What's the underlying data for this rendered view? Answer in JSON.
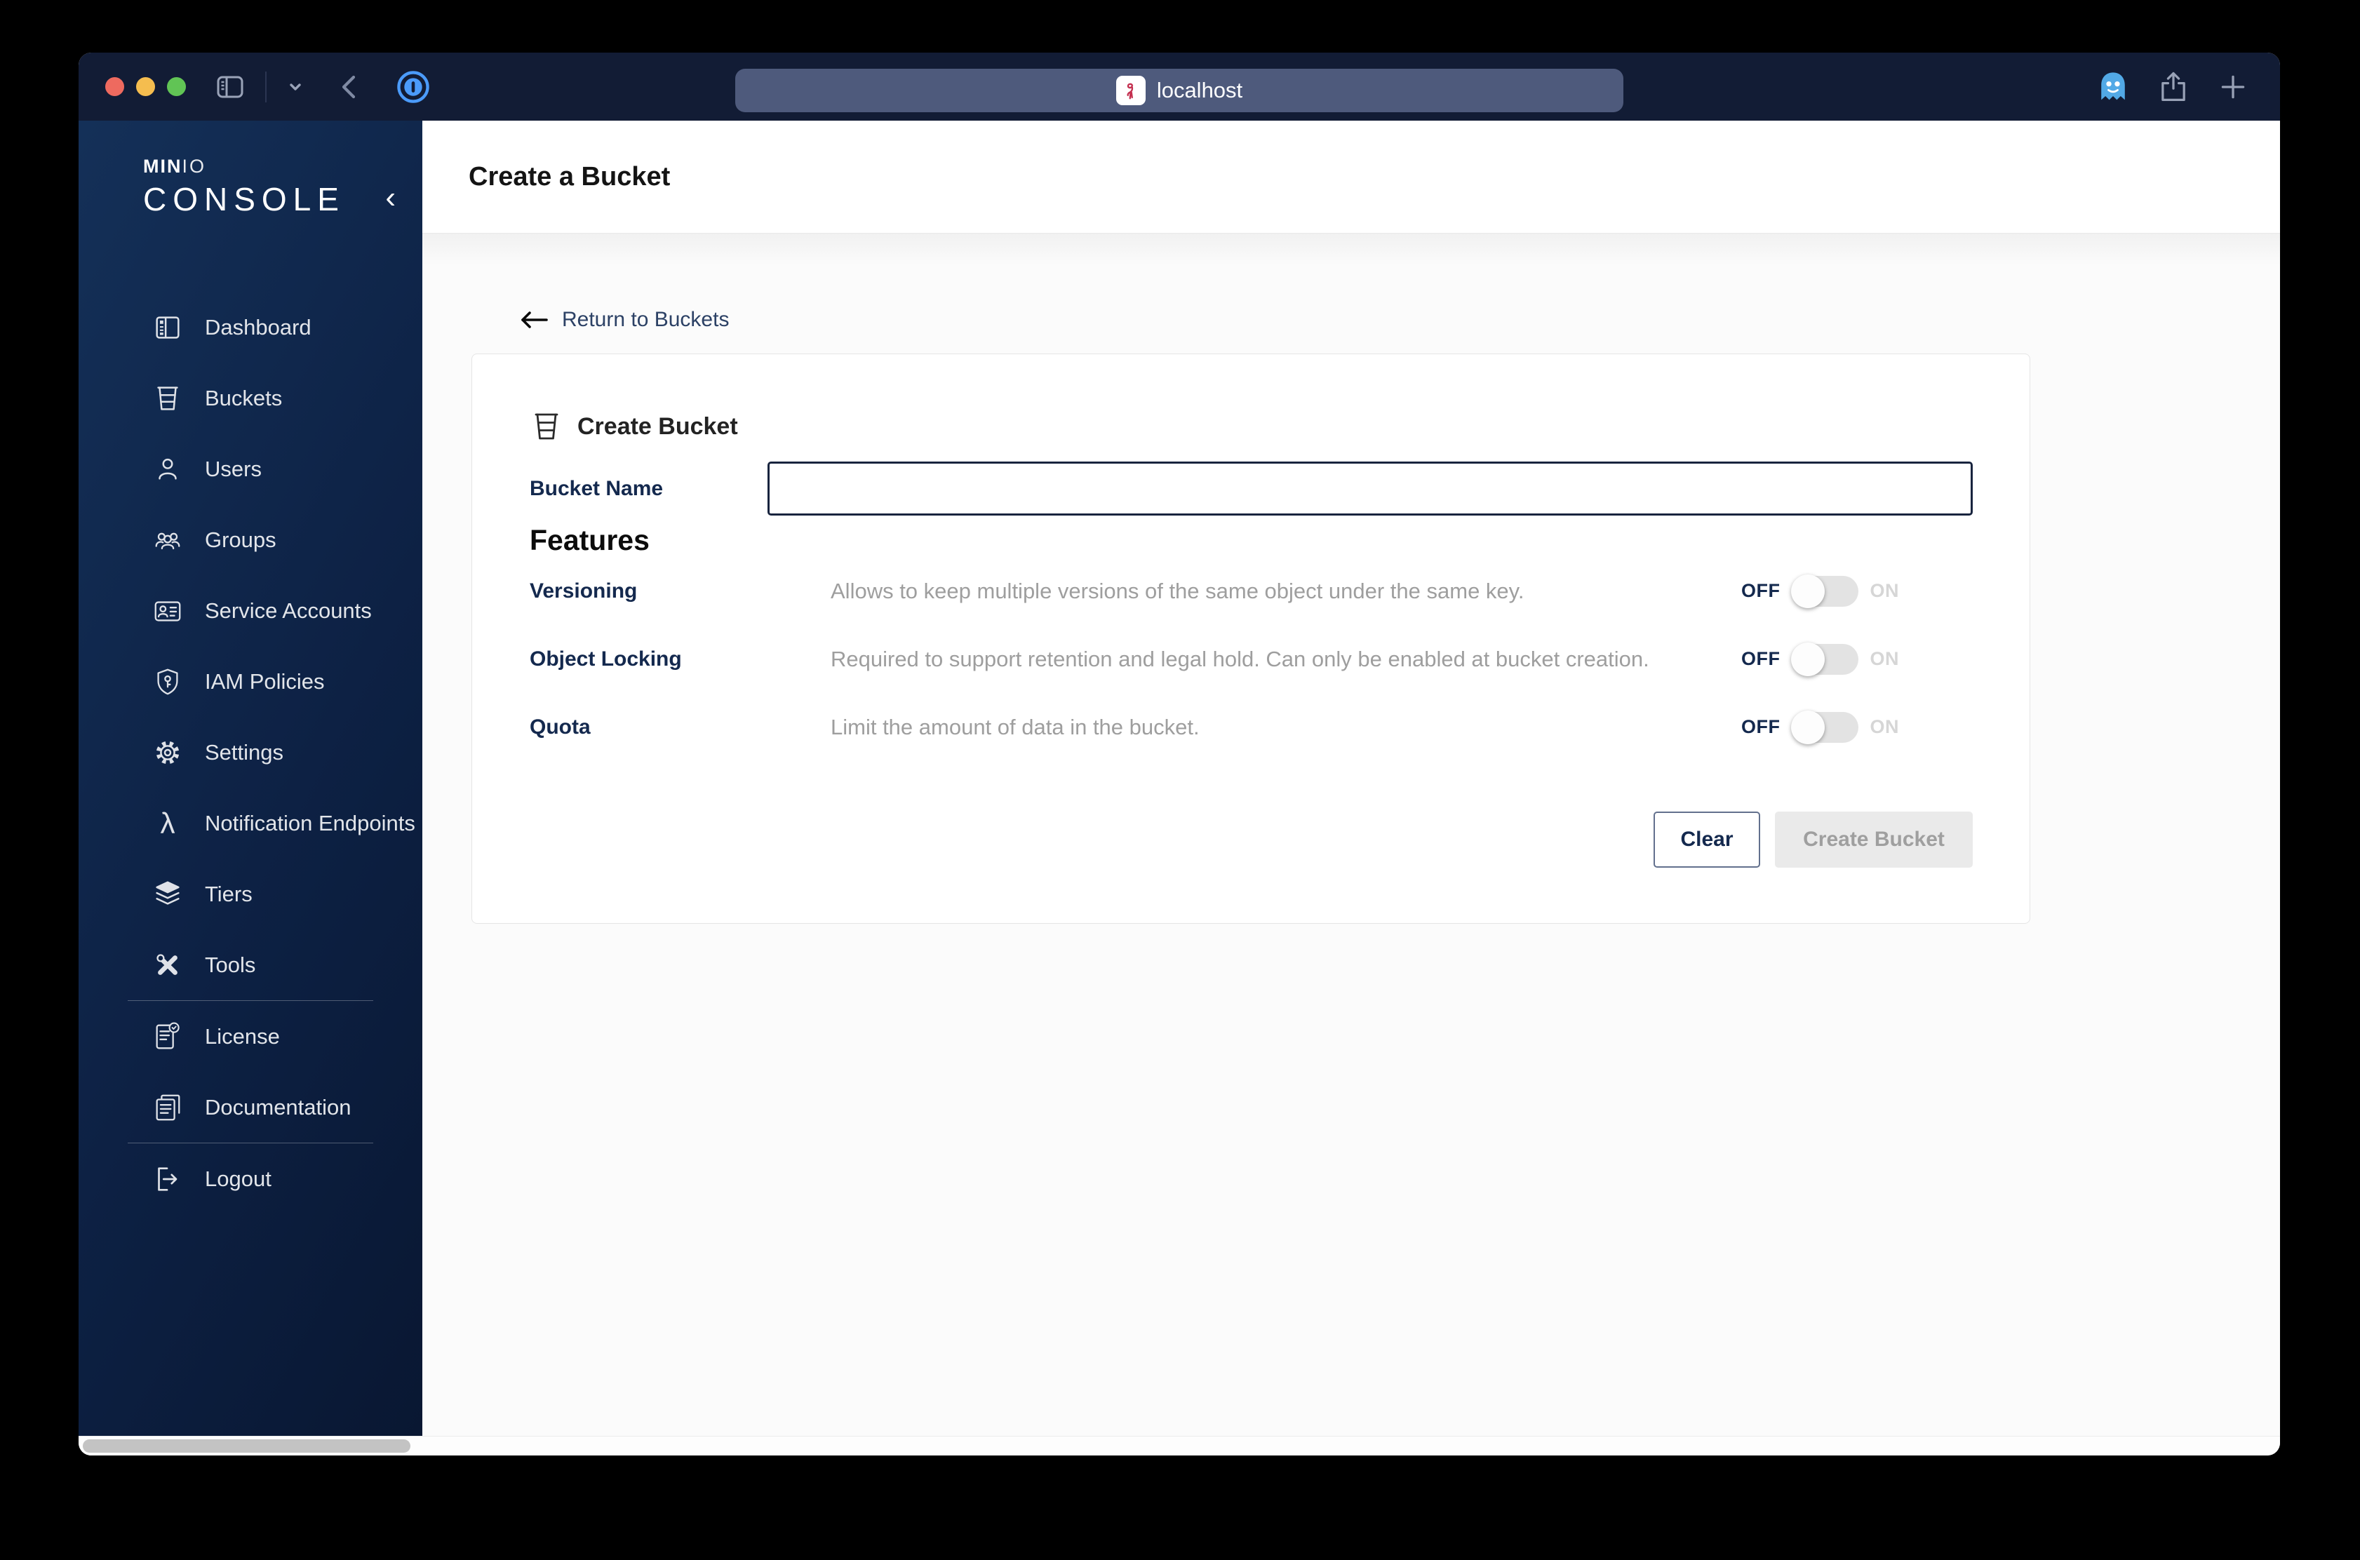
{
  "browser": {
    "url_bar": {
      "text": "localhost"
    },
    "window_controls": [
      "close",
      "minimize",
      "zoom"
    ]
  },
  "sidebar": {
    "logo": {
      "brand_bold": "MIN",
      "brand_light": "IO",
      "product": "CONSOLE",
      "collapse_glyph": "‹"
    },
    "items": [
      {
        "label": "Dashboard",
        "icon": "dashboard-icon"
      },
      {
        "label": "Buckets",
        "icon": "buckets-icon"
      },
      {
        "label": "Users",
        "icon": "users-icon"
      },
      {
        "label": "Groups",
        "icon": "groups-icon"
      },
      {
        "label": "Service Accounts",
        "icon": "service-accounts-icon"
      },
      {
        "label": "IAM Policies",
        "icon": "iam-policies-icon"
      },
      {
        "label": "Settings",
        "icon": "settings-icon"
      },
      {
        "label": "Notification Endpoints",
        "icon": "lambda-icon",
        "icon_glyph": "λ"
      },
      {
        "label": "Tiers",
        "icon": "tiers-icon"
      },
      {
        "label": "Tools",
        "icon": "tools-icon"
      },
      {
        "label": "License",
        "icon": "license-icon"
      },
      {
        "label": "Documentation",
        "icon": "documentation-icon"
      },
      {
        "label": "Logout",
        "icon": "logout-icon"
      }
    ]
  },
  "header": {
    "title": "Create a Bucket"
  },
  "content": {
    "back_link": {
      "label": "Return to Buckets"
    },
    "card": {
      "section_title": "Create Bucket",
      "bucket_name": {
        "label": "Bucket Name",
        "value": "",
        "placeholder": ""
      },
      "features_heading": "Features",
      "features": [
        {
          "name": "Versioning",
          "description": "Allows to keep multiple versions of the same object under the same key.",
          "state": "off",
          "off_label": "OFF",
          "on_label": "ON"
        },
        {
          "name": "Object Locking",
          "description": "Required to support retention and legal hold. Can only be enabled at bucket creation.",
          "state": "off",
          "off_label": "OFF",
          "on_label": "ON"
        },
        {
          "name": "Quota",
          "description": "Limit the amount of data in the bucket.",
          "state": "off",
          "off_label": "OFF",
          "on_label": "ON"
        }
      ],
      "actions": {
        "clear": "Clear",
        "create": "Create Bucket",
        "create_enabled": false
      }
    }
  },
  "colors": {
    "accent_navy": "#14294e",
    "toolbar": "#121c35",
    "sidebar_top": "#143058",
    "sidebar_bottom": "#091732",
    "traffic_red": "#ee6a5f",
    "traffic_yellow": "#f5bd4f",
    "traffic_green": "#61c455",
    "disabled_bg": "#eaeaea",
    "disabled_text": "#9f9f9f"
  }
}
